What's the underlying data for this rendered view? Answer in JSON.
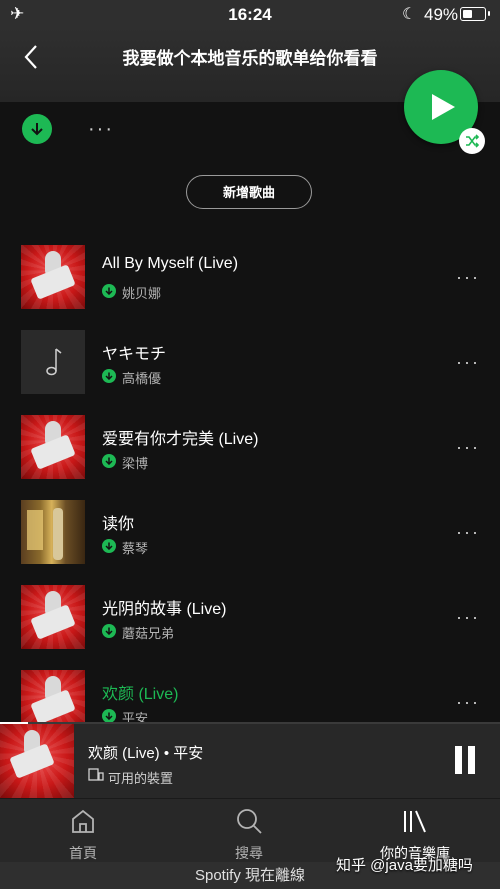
{
  "status_bar": {
    "airplane_icon": "airplane-icon",
    "time": "16:24",
    "moon_icon": "moon-icon",
    "battery": "49%"
  },
  "header": {
    "title": "我要做个本地音乐的歌单给你看看",
    "back_icon": "chevron-left-icon"
  },
  "actions": {
    "play_icon": "play-icon",
    "shuffle_icon": "shuffle-icon",
    "download_icon": "download-icon",
    "more": "···",
    "add_song": "新增歌曲"
  },
  "tracks": [
    {
      "name": "All By Myself (Live)",
      "artist": "姚贝娜",
      "cover": "voice"
    },
    {
      "name": "ヤキモチ",
      "artist": "高橋優",
      "cover": "note"
    },
    {
      "name": "爱要有你才完美 (Live)",
      "artist": "梁博",
      "cover": "voice"
    },
    {
      "name": "读你",
      "artist": "蔡琴",
      "cover": "photo"
    },
    {
      "name": "光阴的故事 (Live)",
      "artist": "蘑菇兄弟",
      "cover": "voice"
    },
    {
      "name": "欢颜 (Live)",
      "artist": "平安",
      "cover": "voice",
      "playing": true
    }
  ],
  "now_playing": {
    "title": "欢颜 (Live) • 平安",
    "device": "可用的裝置",
    "progress": 0.056
  },
  "tabs": [
    {
      "label": "首頁",
      "icon": "home-icon"
    },
    {
      "label": "搜尋",
      "icon": "search-icon"
    },
    {
      "label": "你的音樂庫",
      "icon": "library-icon",
      "active": true
    }
  ],
  "offline_banner": "Spotify 現在離線",
  "watermark": "知乎 @java要加糖吗",
  "colors": {
    "accent": "#1db954",
    "background": "#121212",
    "bar": "#282828"
  }
}
